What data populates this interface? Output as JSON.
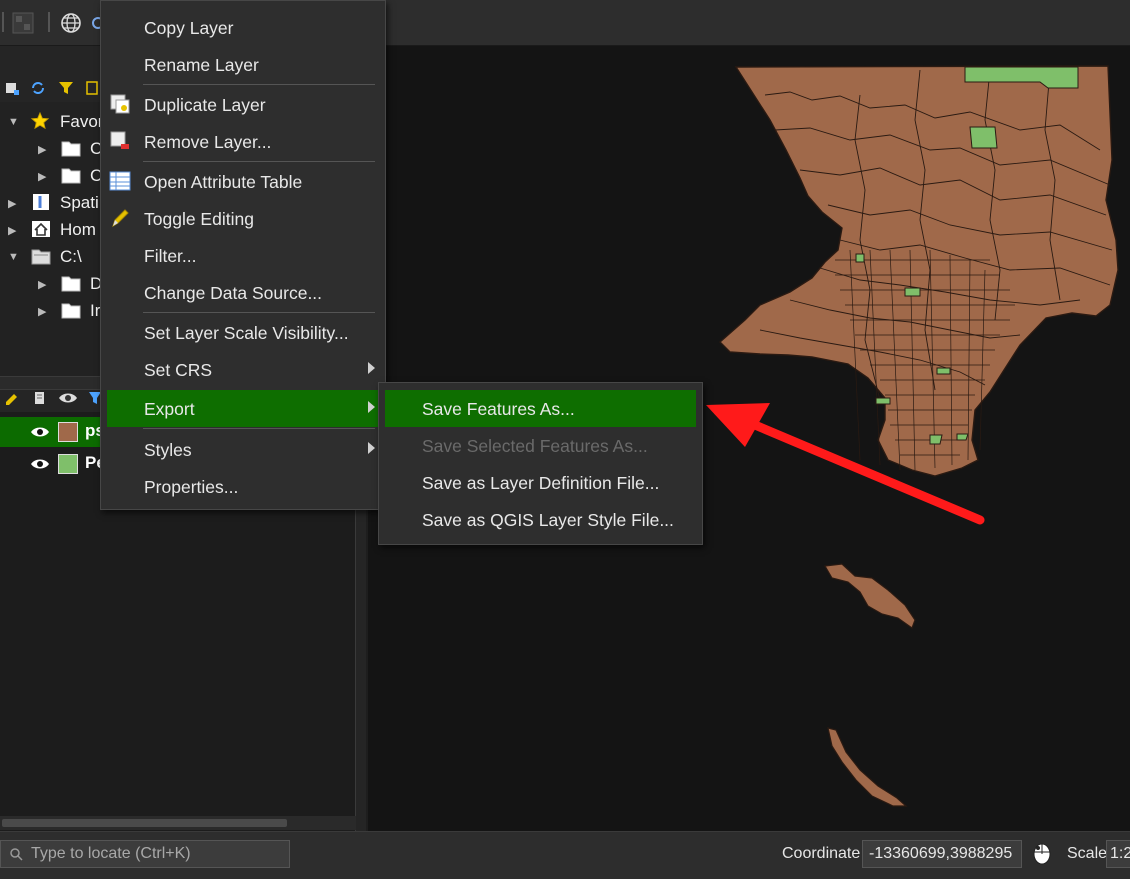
{
  "context_menu": {
    "items": [
      {
        "label": "Copy Layer"
      },
      {
        "label": "Rename Layer"
      },
      {
        "label": "Duplicate Layer"
      },
      {
        "label": "Remove Layer..."
      },
      {
        "label": "Open Attribute Table"
      },
      {
        "label": "Toggle Editing"
      },
      {
        "label": "Filter..."
      },
      {
        "label": "Change Data Source..."
      },
      {
        "label": "Set Layer Scale Visibility..."
      },
      {
        "label": "Set CRS"
      },
      {
        "label": "Export"
      },
      {
        "label": "Styles"
      },
      {
        "label": "Properties..."
      }
    ],
    "active_item": "Export"
  },
  "export_submenu": {
    "items": [
      {
        "label": "Save Features As...",
        "state": "highlighted"
      },
      {
        "label": "Save Selected Features As...",
        "state": "disabled"
      },
      {
        "label": "Save as Layer Definition File...",
        "state": "enabled"
      },
      {
        "label": "Save as QGIS Layer Style File...",
        "state": "enabled"
      }
    ]
  },
  "browser_panel": {
    "items": [
      {
        "label": "Favor",
        "icon": "star-icon",
        "expanded": true
      },
      {
        "label": "C",
        "icon": "folder-icon",
        "expanded": false
      },
      {
        "label": "C",
        "icon": "folder-icon",
        "expanded": false
      },
      {
        "label": "Spati",
        "icon": "spatialite-icon",
        "expanded": false
      },
      {
        "label": "Hom",
        "icon": "home-icon",
        "expanded": false
      },
      {
        "label": "C:\\",
        "icon": "drive-icon",
        "expanded": true
      },
      {
        "label": "D",
        "icon": "folder-icon",
        "expanded": false
      },
      {
        "label": "Ir",
        "icon": "folder-icon",
        "expanded": false
      }
    ]
  },
  "layers_panel": {
    "layers": [
      {
        "name": "ps",
        "visible": true,
        "selected": true,
        "swatch_color": "#a0694a"
      },
      {
        "name": "Pe",
        "visible": true,
        "selected": false,
        "swatch_color": "#7fbf6a"
      }
    ]
  },
  "status_bar": {
    "locator_placeholder": "Type to locate (Ctrl+K)",
    "coordinate_label": "Coordinate",
    "coordinate_value": "-13360699,3988295",
    "scale_label": "Scale",
    "scale_value": "1:2"
  },
  "colors": {
    "highlight": "#0e6e00",
    "map_fill": "#a0694a",
    "park_fill": "#7fbf6a",
    "annotation_arrow": "#ff1a1a"
  }
}
